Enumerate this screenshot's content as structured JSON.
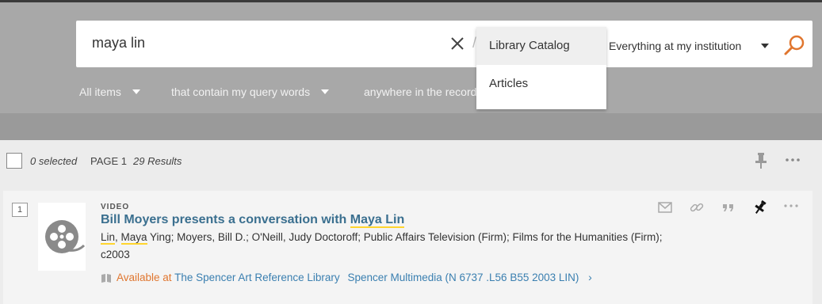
{
  "search": {
    "query": "maya lin",
    "scope": "Everything at my institution"
  },
  "scope_dropdown": {
    "options": [
      "Library Catalog",
      "Articles"
    ],
    "highlighted": "Library Catalog"
  },
  "filters": {
    "material": "All items",
    "match": "that contain my query words",
    "field": "anywhere in the record"
  },
  "results_bar": {
    "selected": "0 selected",
    "page": "PAGE 1",
    "count": "29 Results"
  },
  "results": [
    {
      "index": "1",
      "type": "VIDEO",
      "title_prefix": "Bill Moyers presents a conversation with ",
      "title_highlight": "Maya Lin",
      "author_hl1": "Lin",
      "author_sep": ", ",
      "author_hl2": "Maya",
      "author_rest": " Ying; Moyers, Bill D.; O'Neill, Judy Doctoroff; Public Affairs Television (Firm); Films for the Humanities (Firm);",
      "date": "c2003",
      "availability_status": "Available at",
      "availability_library": "The Spencer Art Reference Library",
      "availability_location": "Spencer Multimedia (N 6737 .L56 B55 2003 LIN)"
    }
  ],
  "colors": {
    "search_band": "#a8a8a8",
    "link": "#3a6f8f",
    "available": "#e0762f",
    "highlight": "#ffd52e",
    "search_icon": "#e0762f"
  }
}
